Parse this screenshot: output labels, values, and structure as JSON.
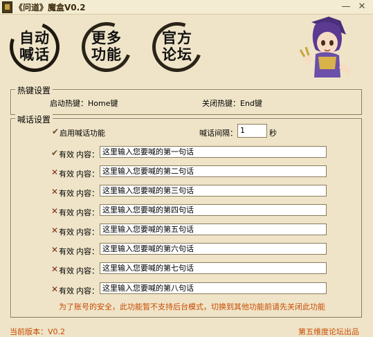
{
  "window": {
    "title": "《问道》魔盒V0.2",
    "minimize": "—",
    "close": "✕"
  },
  "nav": [
    {
      "line1": "自动",
      "line2": "喊话"
    },
    {
      "line1": "更多",
      "line2": "功能"
    },
    {
      "line1": "官方",
      "line2": "论坛"
    }
  ],
  "hotkeys": {
    "group_title": "热键设置",
    "start_label": "启动热键：Home键",
    "stop_label": "关闭热键：End键"
  },
  "shout": {
    "group_title": "喊话设置",
    "enable_label": "启用喊话功能",
    "enable_checked": true,
    "interval_label": "喊话间隔：",
    "interval_value": "1",
    "interval_unit": "秒",
    "rows": [
      {
        "valid": true,
        "valid_label": "有效",
        "content_label": "内容：",
        "value": "这里输入您要喊的第一句话"
      },
      {
        "valid": false,
        "valid_label": "有效",
        "content_label": "内容：",
        "value": "这里输入您要喊的第二句话"
      },
      {
        "valid": false,
        "valid_label": "有效",
        "content_label": "内容：",
        "value": "这里输入您要喊的第三句话"
      },
      {
        "valid": false,
        "valid_label": "有效",
        "content_label": "内容：",
        "value": "这里输入您要喊的第四句话"
      },
      {
        "valid": false,
        "valid_label": "有效",
        "content_label": "内容：",
        "value": "这里输入您要喊的第五句话"
      },
      {
        "valid": false,
        "valid_label": "有效",
        "content_label": "内容：",
        "value": "这里输入您要喊的第六句话"
      },
      {
        "valid": false,
        "valid_label": "有效",
        "content_label": "内容：",
        "value": "这里输入您要喊的第七句话"
      },
      {
        "valid": false,
        "valid_label": "有效",
        "content_label": "内容：",
        "value": "这里输入您要喊的第八句话"
      }
    ],
    "notice": "为了账号的安全，此功能暂不支持后台模式，切换到其他功能前请先关闭此功能"
  },
  "status": {
    "version": "当前版本：V0.2",
    "credit": "第五维度论坛出品"
  },
  "colors": {
    "background": "#efe4c8",
    "accent": "#c84b00",
    "check": "#6a4a2a",
    "cross": "#7a2a1a"
  }
}
